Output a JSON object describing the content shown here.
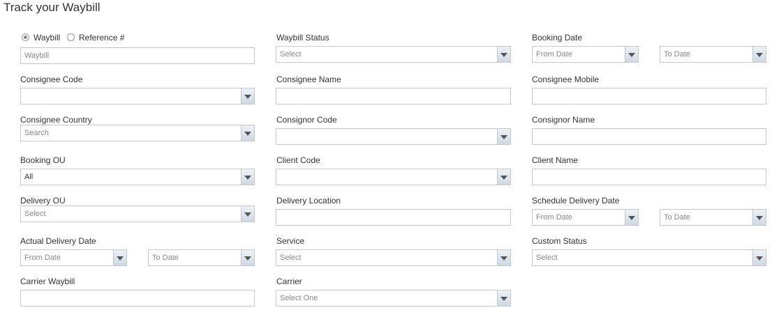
{
  "title": "Track your Waybill",
  "search_mode": {
    "waybill_label": "Waybill",
    "reference_label": "Reference #",
    "selected": "Waybill"
  },
  "waybill_input": {
    "placeholder": "Waybill"
  },
  "waybill_status": {
    "label": "Waybill Status",
    "value": "Select"
  },
  "booking_date": {
    "label": "Booking Date",
    "from": "From Date",
    "to": "To Date"
  },
  "consignee_code": {
    "label": "Consignee Code",
    "value": ""
  },
  "consignee_name": {
    "label": "Consignee Name",
    "value": ""
  },
  "consignee_mobile": {
    "label": "Consignee Mobile",
    "value": ""
  },
  "consignee_country": {
    "label": "Consignee Country",
    "value": "Search"
  },
  "consignor_code": {
    "label": "Consignor Code",
    "value": ""
  },
  "consignor_name": {
    "label": "Consignor Name",
    "value": ""
  },
  "booking_ou": {
    "label": "Booking OU",
    "value": "All"
  },
  "client_code": {
    "label": "Client Code",
    "value": ""
  },
  "client_name": {
    "label": "Client Name",
    "value": ""
  },
  "delivery_ou": {
    "label": "Delivery OU",
    "value": "Select"
  },
  "delivery_location": {
    "label": "Delivery Location",
    "value": ""
  },
  "schedule_delivery_date": {
    "label": "Schedule Delivery Date",
    "from": "From Date",
    "to": "To Date"
  },
  "actual_delivery_date": {
    "label": "Actual Delivery Date",
    "from": "From Date",
    "to": "To Date"
  },
  "service": {
    "label": "Service",
    "value": "Select"
  },
  "custom_status": {
    "label": "Custom Status",
    "value": "Select"
  },
  "carrier_waybill": {
    "label": "Carrier Waybill",
    "value": ""
  },
  "carrier": {
    "label": "Carrier",
    "value": "Select One"
  }
}
